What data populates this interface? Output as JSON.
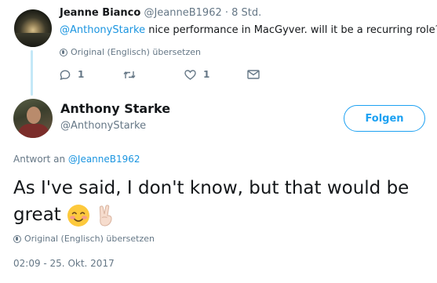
{
  "parent_tweet": {
    "author_name": "Jeanne Bianco",
    "author_handle": "@JeanneB1962",
    "separator": "·",
    "time": "8 Std.",
    "mention": "@AnthonyStarke",
    "text": " nice performance in MacGyver.  will it be a recurring role?",
    "translate_label": "Original (Englisch) übersetzen",
    "reply_count": "1",
    "like_count": "1"
  },
  "main_tweet": {
    "author_name": "Anthony Starke",
    "author_handle": "@AnthonyStarke",
    "follow_label": "Folgen",
    "reply_prefix": "Antwort an ",
    "reply_mention": "@JeanneB1962",
    "text": "As I've said, I don't know, but that would be great",
    "translate_label": "Original (Englisch) übersetzen",
    "timestamp": "02:09 - 25. Okt. 2017"
  },
  "icons": [
    "globe-icon",
    "reply-icon",
    "retweet-icon",
    "like-icon",
    "message-icon",
    "blush-emoji-icon",
    "victory-hand-icon"
  ],
  "colors": {
    "link": "#1b95e0",
    "accent": "#1da1f2",
    "muted": "#657786",
    "thread": "#c4e8f7"
  }
}
